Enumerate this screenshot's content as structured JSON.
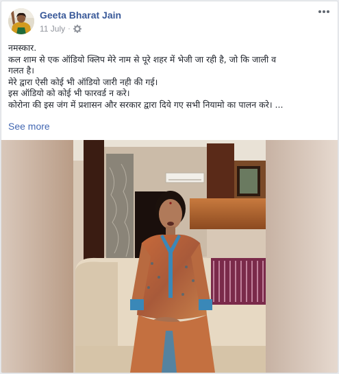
{
  "post": {
    "author": "Geeta Bharat Jain",
    "date": "11 July",
    "separator": "·",
    "privacy_icon": "gear-icon",
    "more_icon": "more-options-icon",
    "text_lines": [
      "नमस्कार.",
      "कल शाम से एक ऑडियो क्लिप मेरे नाम से पूरे शहर में भेजी जा रही है, जो कि जाली व",
      "गलत है।",
      "मेरे द्वारा ऐसी कोई भी ऑडियो जारी नही की गई।",
      "इस ऑडियो को कोई भी फारवर्ड न करे।",
      "कोरोना की इस जंग में प्रशासन और सरकार द्वारा दिये गए सभी नियामो का पालन करे। ..."
    ],
    "see_more": "See more",
    "colors": {
      "author": "#385898",
      "link": "#4267b2",
      "meta": "#90949c",
      "text": "#1d2129"
    }
  }
}
